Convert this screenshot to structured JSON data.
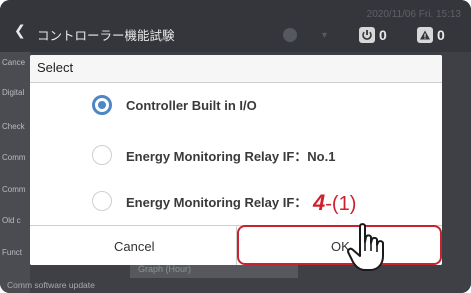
{
  "header": {
    "title": "コントローラー機能試験",
    "datetime": "2020/11/06 Fri. 15:13",
    "power_count": "0",
    "warning_count": "0"
  },
  "sidebar": {
    "items": [
      "Cance",
      "Digital",
      "Check",
      "Comm",
      "Comm",
      "Old c",
      "Funct"
    ]
  },
  "background": {
    "graph_button": "Graph (Hour)",
    "bottom_text": "Comm software update"
  },
  "dialog": {
    "title": "Select",
    "options": [
      {
        "label": "Controller Built in I/O",
        "selected": true
      },
      {
        "label": "Energy Monitoring Relay IF：No.1",
        "selected": false
      },
      {
        "label": "Energy Monitoring Relay IF：",
        "selected": false
      }
    ],
    "cancel_label": "Cancel",
    "ok_label": "OK"
  },
  "annotation": {
    "step_number": "4",
    "step_sub": "-(1)",
    "color": "#c8222f"
  },
  "colors": {
    "accent": "#4e86c6",
    "titlebar": "#34363b"
  }
}
